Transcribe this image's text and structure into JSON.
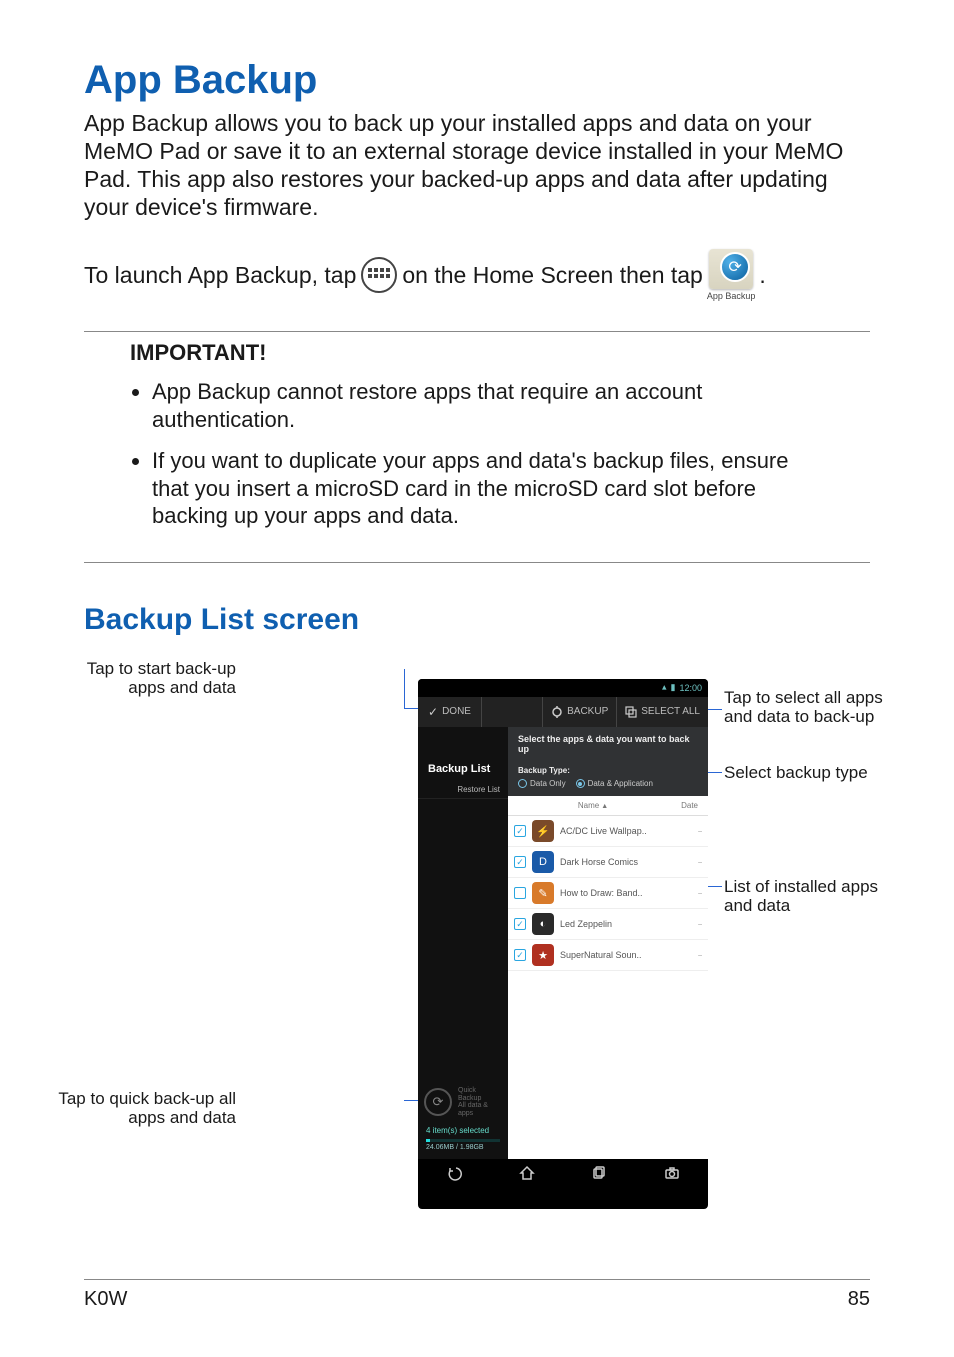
{
  "title": "App Backup",
  "intro": "App Backup allows you to back up your installed apps and data on your MeMO Pad or save it to an external storage device installed in your MeMO Pad. This app also restores your backed-up apps and data after updating your device's firmware.",
  "launch": {
    "pre": "To launch App Backup, tap ",
    "mid": " on the Home Screen then tap ",
    "post": ".",
    "app_icon_label": "App Backup"
  },
  "important": {
    "label": "IMPORTANT!",
    "items": [
      "App Backup cannot restore apps that require an account authentication.",
      "If you want to duplicate your apps and data's backup files, ensure that you insert a microSD card in the microSD card slot before backing up your apps and data."
    ]
  },
  "section2": "Backup List screen",
  "callouts": {
    "start_backup": "Tap to start back-up apps and data",
    "select_all": "Tap to select all apps and data to back-up",
    "backup_type": "Select backup type",
    "app_list": "List of installed apps and data",
    "quick_backup": "Tap to quick back-up all apps and data"
  },
  "phone": {
    "status_time": "12:00",
    "topbar": {
      "done": "DONE",
      "backup": "BACKUP",
      "select_all": "SELECT ALL"
    },
    "sidebar": {
      "title": "Backup List",
      "restore": "Restore List",
      "quick": {
        "line1": "Quick",
        "line2": "Backup",
        "line3": "All data &",
        "line4": "apps"
      },
      "selected": "4 item(s) selected",
      "size": "24.06MB / 1.98GB"
    },
    "main": {
      "header": "Select the apps & data you want to back up",
      "backup_type_label": "Backup Type:",
      "radio_data_only": "Data Only",
      "radio_data_app": "Data & Application",
      "col_name": "Name",
      "col_date": "Date",
      "apps": [
        {
          "checked": true,
          "name": "AC/DC Live Wallpap..",
          "color": "#7a4a2a",
          "glyph": "⚡"
        },
        {
          "checked": true,
          "name": "Dark Horse Comics",
          "color": "#1a5aa8",
          "glyph": "D"
        },
        {
          "checked": false,
          "name": "How to Draw: Band..",
          "color": "#d87a2a",
          "glyph": "✎"
        },
        {
          "checked": true,
          "name": "Led Zeppelin",
          "color": "#2a2a2a",
          "glyph": "◐"
        },
        {
          "checked": true,
          "name": "SuperNatural Soun..",
          "color": "#b03020",
          "glyph": "★"
        }
      ]
    }
  },
  "footer": {
    "model": "K0W",
    "page": "85"
  }
}
